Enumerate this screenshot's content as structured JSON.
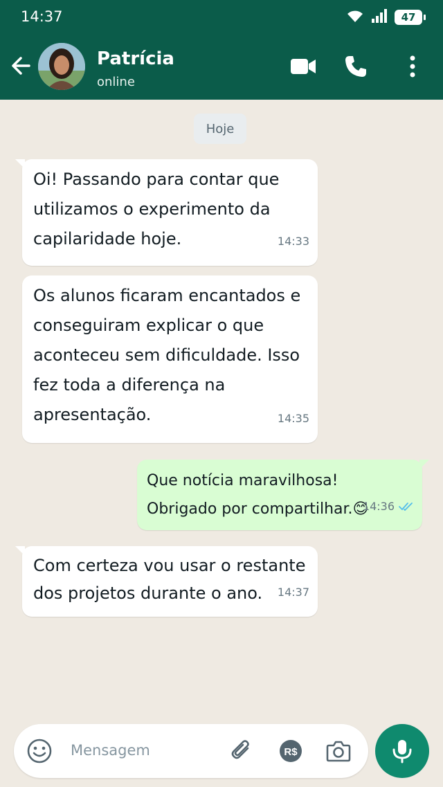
{
  "status_bar": {
    "time": "14:37",
    "battery": "47"
  },
  "header": {
    "contact_name": "Patrícia",
    "contact_status": "online"
  },
  "chat": {
    "date_chip": "Hoje",
    "messages": [
      {
        "direction": "incoming",
        "text": "Oi! Passando para contar que utilizamos o experimento da capilaridade hoje.",
        "time": "14:33"
      },
      {
        "direction": "incoming",
        "text": "Os alunos ficaram encantados e conseguiram explicar o que aconteceu sem dificuldade. Isso fez toda a diferença na apresentação.",
        "time": "14:35"
      },
      {
        "direction": "outgoing",
        "text": "Que notícia maravilhosa! Obrigado por compartilhar.😊",
        "time": "14:36",
        "read": true
      },
      {
        "direction": "incoming",
        "text": "Com certeza vou usar o restante dos projetos durante o ano.",
        "time": "14:37"
      }
    ]
  },
  "composer": {
    "placeholder": "Mensagem",
    "currency_label": "R$"
  },
  "colors": {
    "header": "#0b5c4a",
    "outgoing_bubble": "#d9fdd3",
    "incoming_bubble": "#ffffff",
    "read_ticks": "#53bdeb",
    "mic_button": "#0f8a6e"
  },
  "icons": [
    "back-arrow-icon",
    "video-call-icon",
    "phone-icon",
    "more-vert-icon",
    "wifi-icon",
    "signal-icon",
    "emoji-icon",
    "attach-icon",
    "payment-icon",
    "camera-icon",
    "mic-icon",
    "double-check-icon"
  ]
}
